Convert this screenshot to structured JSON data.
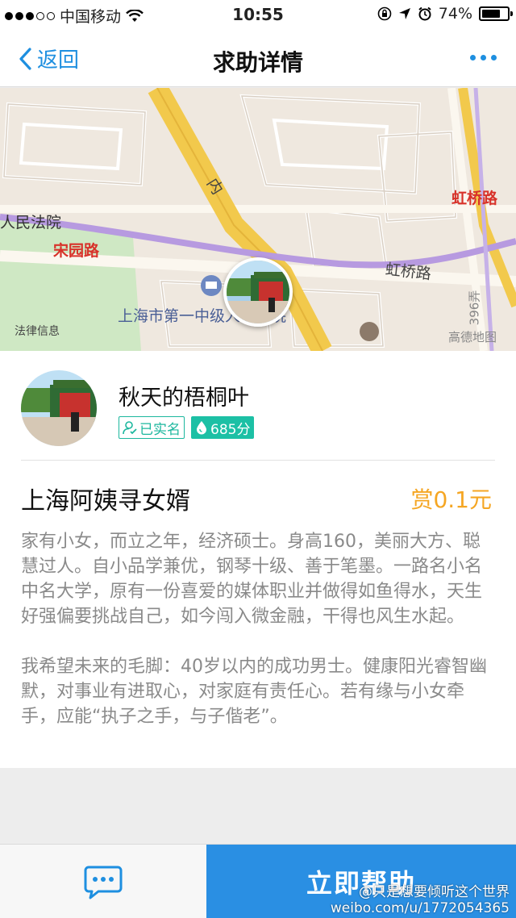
{
  "status_bar": {
    "carrier": "中国移动",
    "time": "10:55",
    "battery": "74%",
    "battery_level": 0.74
  },
  "nav": {
    "back_label": "返回",
    "title": "求助详情"
  },
  "map": {
    "labels": {
      "road_inner": "内",
      "court_partial": "人民法院",
      "songyuan": "宋园路",
      "hongqiao_red": "虹桥路",
      "hongqiao_road": "虹桥路",
      "court_full": "上海市第一中级人民法院",
      "legal_info": "法律信息",
      "gaode": "高德地图",
      "road_num": "396弄"
    }
  },
  "user": {
    "name": "秋天的梧桐叶",
    "verified_label": "已实名",
    "score_label": "685分"
  },
  "post": {
    "title": "上海阿姨寻女婿",
    "reward": "赏0.1元",
    "paragraph1": "家有小女，而立之年，经济硕士。身高160，美丽大方、聪慧过人。自小品学兼优，钢琴十级、善于笔墨。一路名小名中名大学，原有一份喜爱的媒体职业并做得如鱼得水，天生好强偏要挑战自己，如今闯入微金融，干得也风生水起。",
    "paragraph2": "我希望未来的毛脚：40岁以内的成功男士。健康阳光睿智幽默，对事业有进取心，对家庭有责任心。若有缘与小女牵手，应能“执子之手，与子偕老”。"
  },
  "bottom": {
    "help_label": "立即帮助"
  },
  "watermark": {
    "line1": "@只是想要倾听这个世界",
    "line2": "weibo.com/u/1772054365"
  },
  "colors": {
    "accent": "#1e8fe0",
    "help_button": "#2a8fe3",
    "reward": "#f5a623",
    "badge_green": "#1cb79e"
  }
}
